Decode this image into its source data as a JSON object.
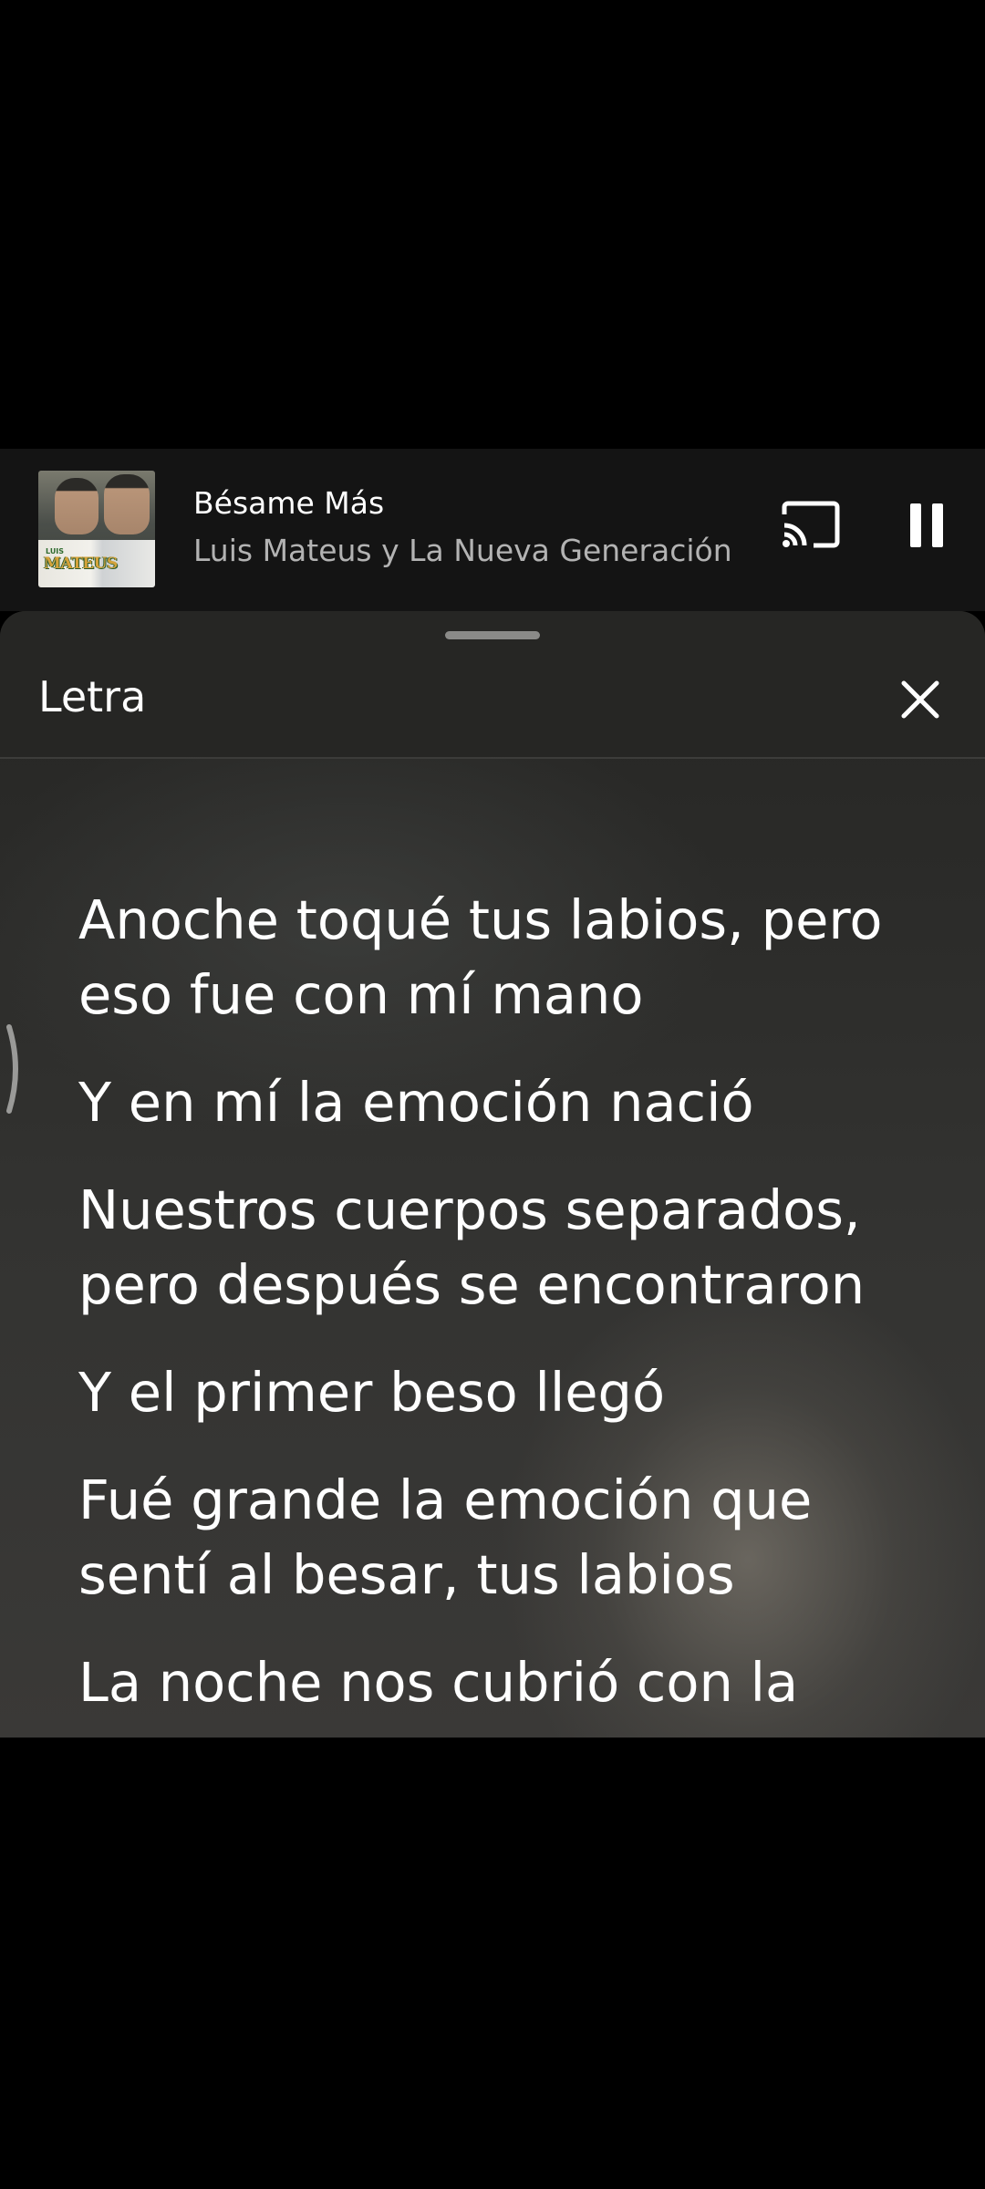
{
  "player": {
    "title": "Bésame Más",
    "artist": "Luis Mateus y La Nueva Generación",
    "album_art_text": "LUIS MATEUS",
    "cast_icon": "cast-icon",
    "pause_icon": "pause-icon"
  },
  "lyrics_sheet": {
    "title": "Letra",
    "close_icon": "close-icon",
    "lines": [
      "Anoche toqué tus labios, pero eso fue con mí mano",
      "Y en mí la emoción nació",
      "Nuestros cuerpos separados, pero después se encontraron",
      "Y el primer beso llegó",
      "Fué grande la emoción que sentí al besar, tus labios",
      "La noche nos cubrió con la"
    ]
  },
  "colors": {
    "background": "#000000",
    "player_bg": "#141414",
    "sheet_header_bg": "#262624",
    "text_primary": "#ffffff",
    "text_secondary": "#b3b3b3"
  }
}
